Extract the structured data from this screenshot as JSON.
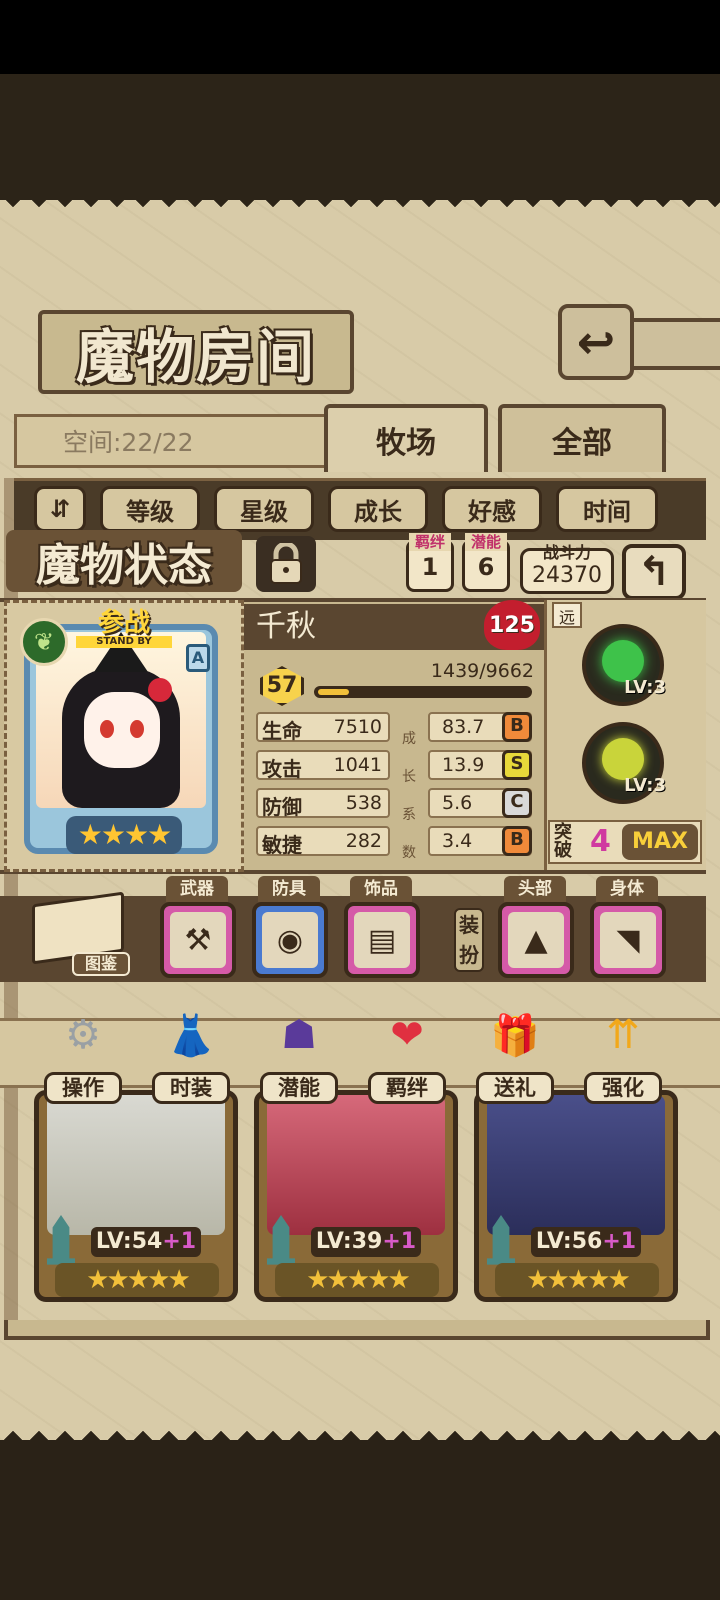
{
  "room": {
    "title": "魔物房间",
    "space_label": "空间:22/22",
    "tabs": [
      "牧场",
      "全部"
    ],
    "sort_options": [
      "等级",
      "星级",
      "成长",
      "好感",
      "时间"
    ],
    "back_icon": "return-arrow-icon"
  },
  "status": {
    "title": "魔物状态",
    "lock_icon": "lock-icon",
    "bond_label": "羁绊",
    "bond_value": "1",
    "potential_label": "潜能",
    "potential_value": "6",
    "power_label": "战斗力",
    "power_value": "24370"
  },
  "monster": {
    "name": "千秋",
    "standby_cn": "参战",
    "standby_en": "STAND BY",
    "rank": "A",
    "affection": "125",
    "level": "57",
    "exp": "1439/9662",
    "exp_fraction": 0.149,
    "stars": "★★★★",
    "stats": [
      {
        "label": "生命",
        "value": "7510",
        "growth": "83.7",
        "grade": "B",
        "grade_color": "#f08a3a"
      },
      {
        "label": "攻击",
        "value": "1041",
        "growth": "13.9",
        "grade": "S",
        "grade_color": "#e8d83a"
      },
      {
        "label": "防御",
        "value": "538",
        "growth": "5.6",
        "grade": "C",
        "grade_color": "#d9d9d9"
      },
      {
        "label": "敏捷",
        "value": "282",
        "growth": "3.4",
        "grade": "B",
        "grade_color": "#f08a3a"
      }
    ],
    "growth_column_chars": [
      "成",
      "长",
      "系",
      "数"
    ],
    "range": "远",
    "skills": [
      {
        "level": "LV:3",
        "icon": "green-flower-skill-icon",
        "color": "#3ec24a"
      },
      {
        "level": "LV:3",
        "icon": "shield-skill-icon",
        "color": "#c9d43a"
      }
    ],
    "breakthrough_label": "突破",
    "breakthrough_value": "4",
    "max_label": "MAX"
  },
  "equipment": {
    "codex_label": "图鉴",
    "slots": [
      {
        "label": "武器",
        "icon": "scythe-icon"
      },
      {
        "label": "防具",
        "icon": "round-shield-icon"
      },
      {
        "label": "饰品",
        "icon": "tablet-icon"
      },
      {
        "label": "头部",
        "icon": "witch-hat-icon"
      },
      {
        "label": "身体",
        "icon": "cape-icon"
      }
    ],
    "dress_label": "装扮"
  },
  "actions": [
    {
      "label": "操作",
      "icon": "gear-icon"
    },
    {
      "label": "时装",
      "icon": "outfit-icon"
    },
    {
      "label": "潜能",
      "icon": "shadow-spirit-icon"
    },
    {
      "label": "羁绊",
      "icon": "hearts-icon"
    },
    {
      "label": "送礼",
      "icon": "gift-icon"
    },
    {
      "label": "强化",
      "icon": "upgrade-arrows-icon"
    }
  ],
  "roster": [
    {
      "level": "LV:54",
      "plus": "+1",
      "stars": "★★★★★"
    },
    {
      "level": "LV:39",
      "plus": "+1",
      "stars": "★★★★★"
    },
    {
      "level": "LV:56",
      "plus": "+1",
      "stars": "★★★★★"
    }
  ],
  "colors": {
    "parchment": "#d8cba8",
    "frame": "#5a4630",
    "star": "#f2c03a",
    "affection_heart": "#c31e2e",
    "breakthrough": "#d03aa0"
  }
}
